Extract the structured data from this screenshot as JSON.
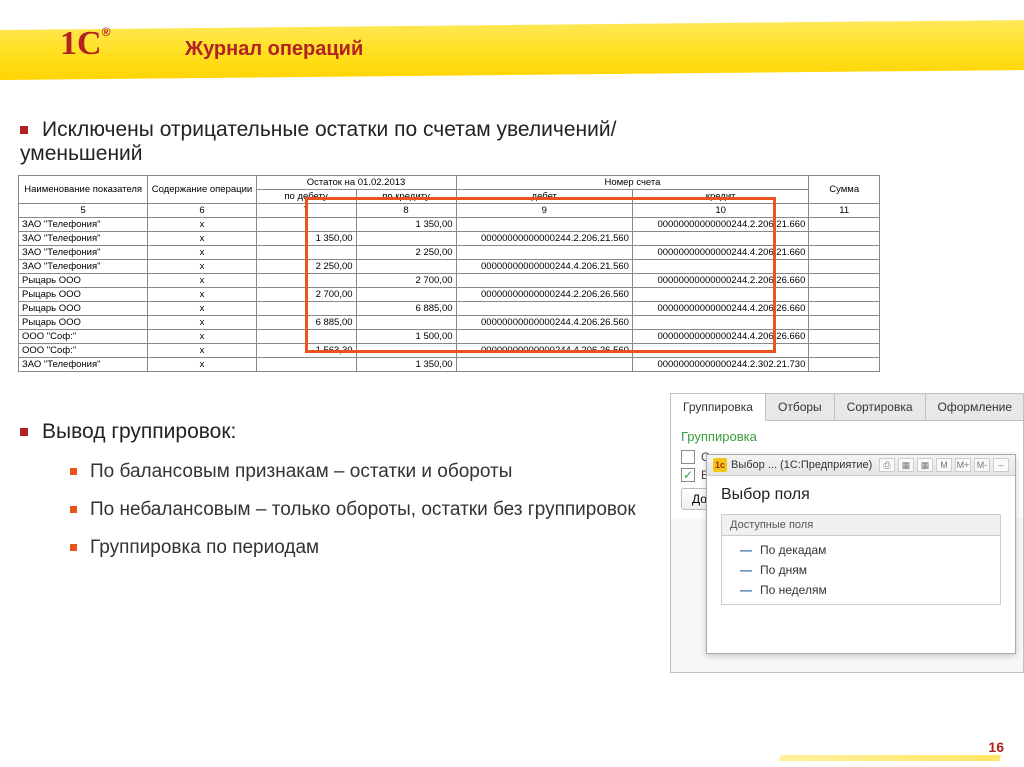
{
  "logo_text": "1С",
  "title": "Журнал операций",
  "bullets": {
    "b1": "Исключены отрицательные остатки по счетам увеличений/уменьшений",
    "b2": "Вывод группировок:",
    "subs": [
      "По балансовым признакам – остатки и обороты",
      "По небалансовым – только обороты, остатки без группировок",
      "Группировка по периодам"
    ]
  },
  "table": {
    "header_top": {
      "name": "Наименование показателя",
      "op": "Содержание операции",
      "balance_on": "Остаток на 01.02.2013",
      "account": "Номер счета",
      "sum": "Сумма"
    },
    "header_sub": {
      "debit": "по дебету",
      "credit": "по кредиту",
      "debet": "дебет",
      "kredit": "кредит"
    },
    "nums": [
      "5",
      "6",
      "7",
      "8",
      "9",
      "10",
      "11"
    ],
    "rows": [
      {
        "name": "ЗАО \"Телефония\"",
        "op": "х",
        "d": "",
        "c": "1 350,00",
        "deb": "",
        "kr": "00000000000000244.2.206.21.660",
        "s": ""
      },
      {
        "name": "ЗАО \"Телефония\"",
        "op": "х",
        "d": "1 350,00",
        "c": "",
        "deb": "00000000000000244.2.206.21.560",
        "kr": "",
        "s": ""
      },
      {
        "name": "ЗАО \"Телефония\"",
        "op": "х",
        "d": "",
        "c": "2 250,00",
        "deb": "",
        "kr": "00000000000000244.4.206.21.660",
        "s": ""
      },
      {
        "name": "ЗАО \"Телефония\"",
        "op": "х",
        "d": "2 250,00",
        "c": "",
        "deb": "00000000000000244.4.206.21.560",
        "kr": "",
        "s": ""
      },
      {
        "name": "Рыцарь ООО",
        "op": "х",
        "d": "",
        "c": "2 700,00",
        "deb": "",
        "kr": "00000000000000244.2.206.26.660",
        "s": ""
      },
      {
        "name": "Рыцарь ООО",
        "op": "х",
        "d": "2 700,00",
        "c": "",
        "deb": "00000000000000244.2.206.26.560",
        "kr": "",
        "s": ""
      },
      {
        "name": "Рыцарь ООО",
        "op": "х",
        "d": "",
        "c": "6 885,00",
        "deb": "",
        "kr": "00000000000000244.4.206.26.660",
        "s": ""
      },
      {
        "name": "Рыцарь ООО",
        "op": "х",
        "d": "6 885,00",
        "c": "",
        "deb": "00000000000000244.4.206.26.560",
        "kr": "",
        "s": ""
      },
      {
        "name": "ООО \"Соф:\"",
        "op": "х",
        "d": "",
        "c": "1 500,00",
        "deb": "",
        "kr": "00000000000000244.4.206.26.660",
        "s": ""
      },
      {
        "name": "ООО \"Соф:\"",
        "op": "х",
        "d": "1 563,30",
        "c": "",
        "deb": "00000000000000244.4.206.26.560",
        "kr": "",
        "s": ""
      },
      {
        "name": "ЗАО \"Телефония\"",
        "op": "х",
        "d": "",
        "c": "1 350,00",
        "deb": "",
        "kr": "00000000000000244.2.302.21.730",
        "s": ""
      }
    ]
  },
  "panel": {
    "tabs": [
      "Группировка",
      "Отборы",
      "Сортировка",
      "Оформление"
    ],
    "section_title": "Группировка",
    "cb1": "Сворачивать однотипные проводки",
    "cb2": "Выводить по каждому разделителю",
    "add_btn": "Добавить",
    "subwindow": {
      "caption": "Выбор ... (1С:Предприятие)",
      "title": "Выбор поля",
      "list_header": "Доступные поля",
      "items": [
        "По декадам",
        "По дням",
        "По неделям"
      ],
      "sw_buttons": [
        "M",
        "M+",
        "M-"
      ]
    }
  },
  "page_number": "16"
}
